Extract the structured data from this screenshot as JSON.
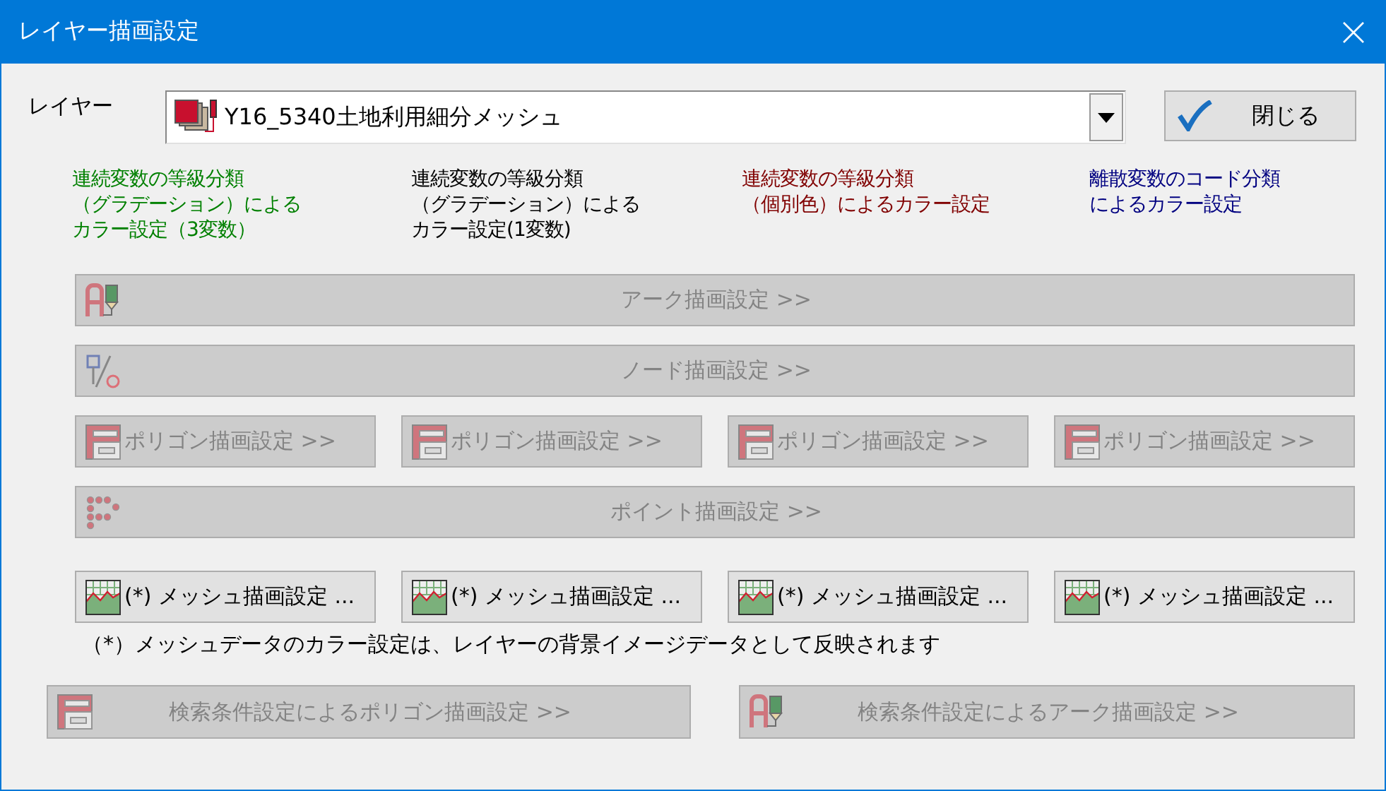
{
  "window": {
    "title": "レイヤー描画設定"
  },
  "layer": {
    "label": "レイヤー",
    "value": "Y16_5340土地利用細分メッシュ"
  },
  "close_button": {
    "label": "閉じる"
  },
  "legend": [
    {
      "lines": [
        "連続変数の等級分類",
        "（グラデーション）による",
        "カラー設定（3変数）"
      ],
      "color": "#008000"
    },
    {
      "lines": [
        "連続変数の等級分類",
        "（グラデーション）による",
        "カラー設定(1変数)"
      ],
      "color": "#000000"
    },
    {
      "lines": [
        "連続変数の等級分類",
        "（個別色）によるカラー設定"
      ],
      "color": "#800000"
    },
    {
      "lines": [
        "離散変数のコード分類",
        "によるカラー設定"
      ],
      "color": "#000080"
    }
  ],
  "button_rows": [
    [
      {
        "kind": "arc",
        "label": "アーク描画設定 >>",
        "disabled": true
      }
    ],
    [
      {
        "kind": "node",
        "label": "ノード描画設定 >>",
        "disabled": true
      }
    ],
    [
      {
        "kind": "polygon",
        "label": "ポリゴン描画設定 >>",
        "disabled": true
      },
      {
        "kind": "polygon",
        "label": "ポリゴン描画設定 >>",
        "disabled": true
      },
      {
        "kind": "polygon",
        "label": "ポリゴン描画設定 >>",
        "disabled": true
      },
      {
        "kind": "polygon",
        "label": "ポリゴン描画設定 >>",
        "disabled": true
      }
    ],
    [
      {
        "kind": "point",
        "label": "ポイント描画設定 >>",
        "disabled": true
      }
    ],
    [
      {
        "kind": "mesh",
        "label": "(*) メッシュ描画設定 ...",
        "disabled": false
      },
      {
        "kind": "mesh",
        "label": "(*) メッシュ描画設定 ...",
        "disabled": false
      },
      {
        "kind": "mesh",
        "label": "(*) メッシュ描画設定 ...",
        "disabled": false
      },
      {
        "kind": "mesh",
        "label": "(*) メッシュ描画設定 ...",
        "disabled": false
      }
    ]
  ],
  "note": "（*）メッシュデータのカラー設定は、レイヤーの背景イメージデータとして反映されます",
  "search_buttons": [
    {
      "kind": "polygon",
      "label": "検索条件設定によるポリゴン描画設定 >>",
      "disabled": true
    },
    {
      "kind": "arc",
      "label": "検索条件設定によるアーク描画設定 >>",
      "disabled": true
    }
  ]
}
